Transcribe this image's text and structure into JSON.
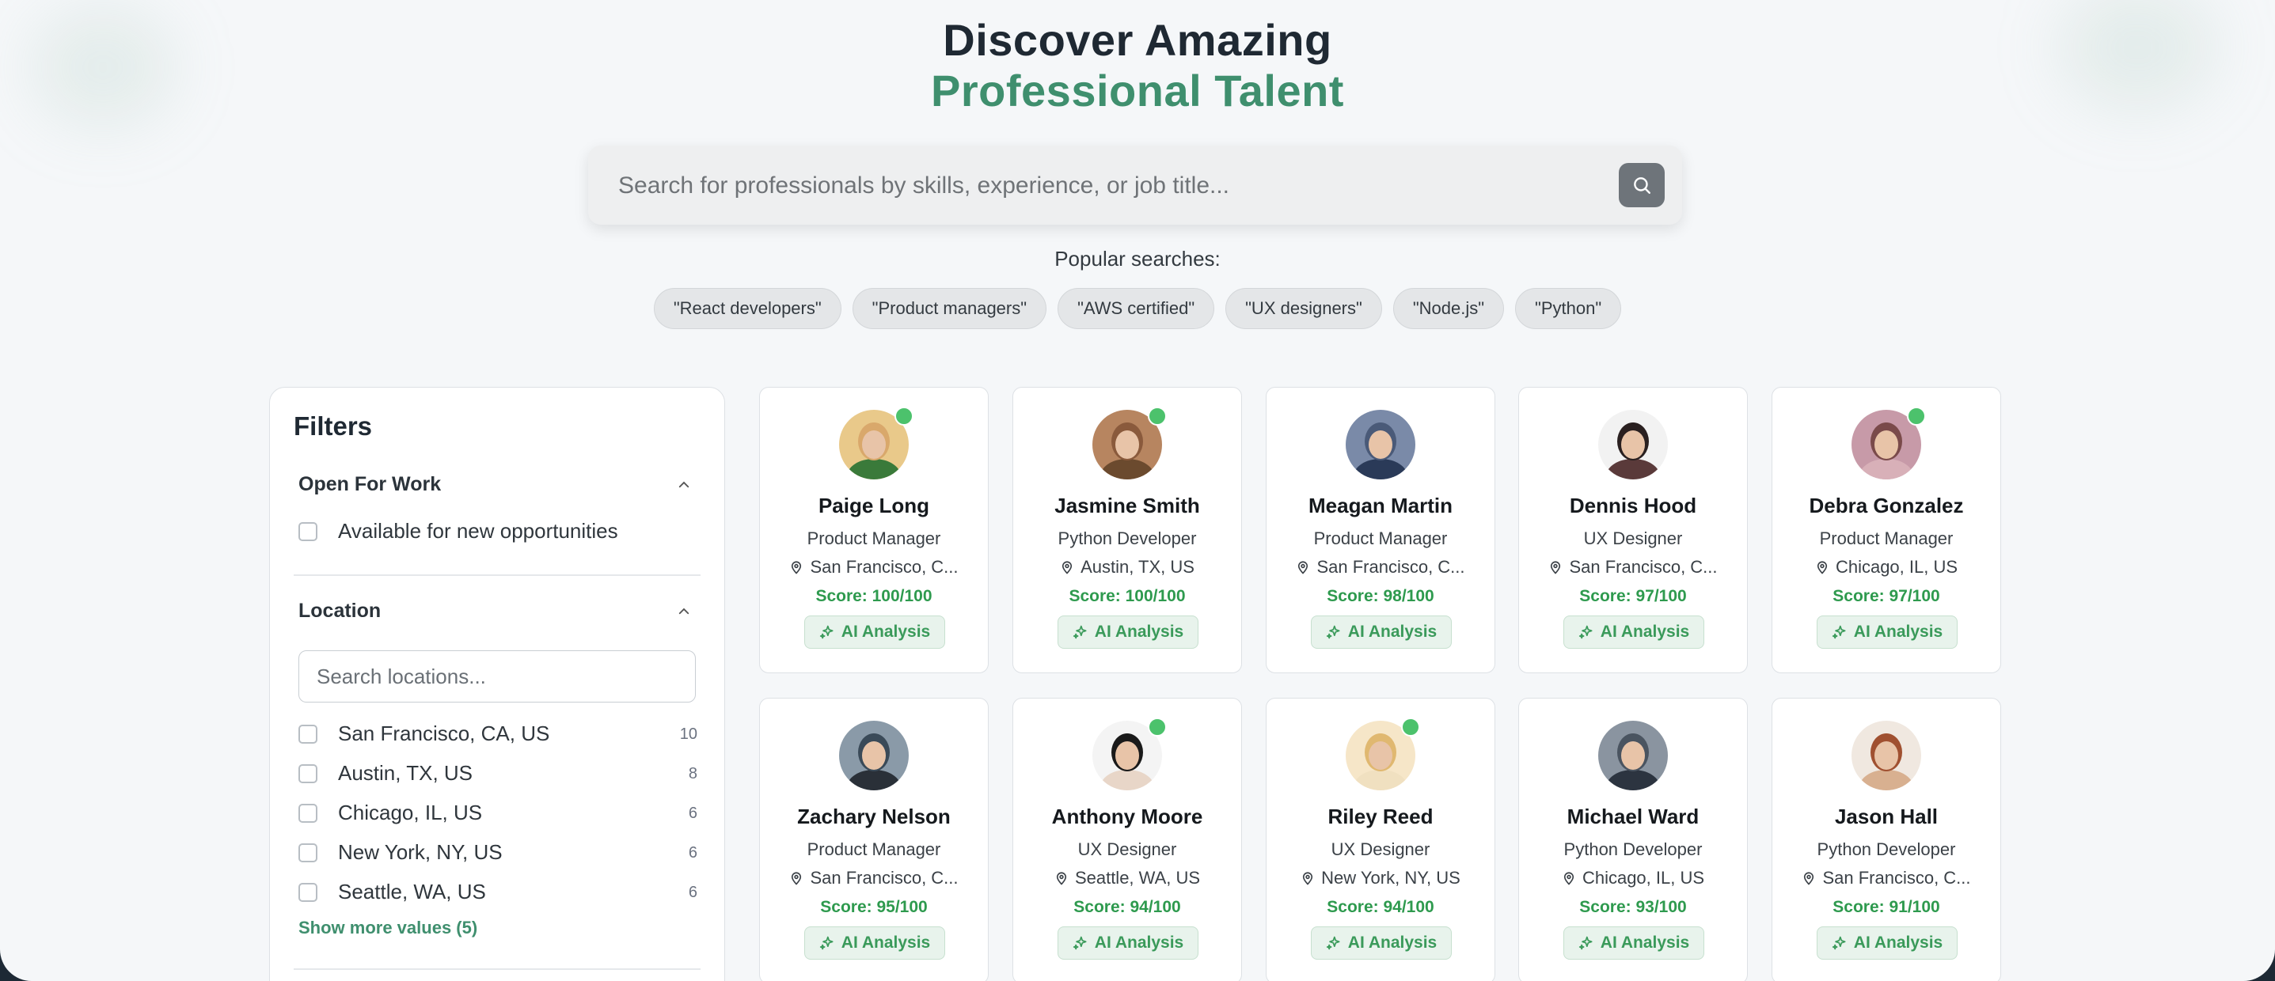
{
  "hero": {
    "title_line1": "Discover Amazing",
    "title_line2": "Professional Talent"
  },
  "search": {
    "placeholder": "Search for professionals by skills, experience, or job title...",
    "button_icon": "search-icon"
  },
  "popular": {
    "label": "Popular searches:",
    "chips": [
      "\"React developers\"",
      "\"Product managers\"",
      "\"AWS certified\"",
      "\"UX designers\"",
      "\"Node.js\"",
      "\"Python\""
    ]
  },
  "filters": {
    "title": "Filters",
    "open_for_work": {
      "heading": "Open For Work",
      "option": "Available for new opportunities"
    },
    "location": {
      "heading": "Location",
      "search_placeholder": "Search locations...",
      "options": [
        {
          "label": "San Francisco, CA, US",
          "count": "10"
        },
        {
          "label": "Austin, TX, US",
          "count": "8"
        },
        {
          "label": "Chicago, IL, US",
          "count": "6"
        },
        {
          "label": "New York, NY, US",
          "count": "6"
        },
        {
          "label": "Seattle, WA, US",
          "count": "6"
        }
      ],
      "show_more": "Show more values (5)"
    }
  },
  "ai_label": "AI Analysis",
  "colors": {
    "accent": "#3f8f6e",
    "score": "#2e9a4e",
    "online": "#4cc26c"
  },
  "profiles": [
    {
      "name": "Paige Long",
      "role": "Product Manager",
      "location": "San Francisco, C...",
      "score": "Score: 100/100",
      "online": true
    },
    {
      "name": "Jasmine Smith",
      "role": "Python Developer",
      "location": "Austin, TX, US",
      "score": "Score: 100/100",
      "online": true
    },
    {
      "name": "Meagan Martin",
      "role": "Product Manager",
      "location": "San Francisco, C...",
      "score": "Score: 98/100",
      "online": false
    },
    {
      "name": "Dennis Hood",
      "role": "UX Designer",
      "location": "San Francisco, C...",
      "score": "Score: 97/100",
      "online": false
    },
    {
      "name": "Debra Gonzalez",
      "role": "Product Manager",
      "location": "Chicago, IL, US",
      "score": "Score: 97/100",
      "online": true
    },
    {
      "name": "Zachary Nelson",
      "role": "Product Manager",
      "location": "San Francisco, C...",
      "score": "Score: 95/100",
      "online": false
    },
    {
      "name": "Anthony Moore",
      "role": "UX Designer",
      "location": "Seattle, WA, US",
      "score": "Score: 94/100",
      "online": true
    },
    {
      "name": "Riley Reed",
      "role": "UX Designer",
      "location": "New York, NY, US",
      "score": "Score: 94/100",
      "online": true
    },
    {
      "name": "Michael Ward",
      "role": "Python Developer",
      "location": "Chicago, IL, US",
      "score": "Score: 93/100",
      "online": false
    },
    {
      "name": "Jason Hall",
      "role": "Python Developer",
      "location": "San Francisco, C...",
      "score": "Score: 91/100",
      "online": false
    }
  ]
}
